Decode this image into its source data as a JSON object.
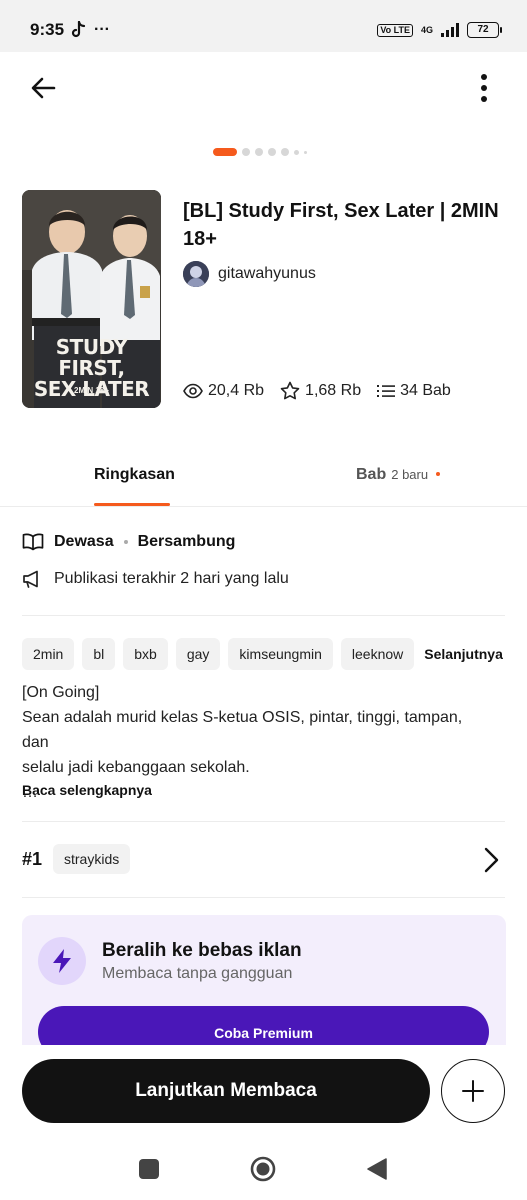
{
  "status_bar": {
    "time": "9:35",
    "overflow": "···",
    "network": "4G",
    "volte": "Vo LTE",
    "battery": "72"
  },
  "header": {
    "back_icon": "arrow-left-icon",
    "more_icon": "more-vertical-icon"
  },
  "carousel": {
    "dot_count": 7,
    "active_index": 0
  },
  "story": {
    "cover_title_line1": "STUDY FIRST,",
    "cover_title_line2": "SEX LATER",
    "cover_subtitle": "2MIN 18+",
    "title": "[BL] Study First, Sex Later | 2MIN 18+",
    "author": "gitawahyunus",
    "reads": "20,4 Rb",
    "votes": "1,68 Rb",
    "parts": "34 Bab"
  },
  "tabs": {
    "summary": "Ringkasan",
    "chapters": "Bab",
    "chapters_badge": "2 baru"
  },
  "meta": {
    "rating": "Dewasa",
    "status": "Bersambung",
    "last_published": "Publikasi terakhir 2 hari yang lalu"
  },
  "tags": [
    "2min",
    "bl",
    "bxb",
    "gay",
    "kimseungmin",
    "leeknow"
  ],
  "tags_more": "Selanjutnya",
  "description": {
    "line1": "[On Going]",
    "line2": "Sean adalah murid kelas S-ketua OSIS, pintar, tinggi, tampan, dan",
    "line3": "selalu jadi kebanggaan sekolah.",
    "ellipsis": "…",
    "read_more": "Baca selengkapnya"
  },
  "ranking": {
    "position": "#1",
    "tag": "straykids"
  },
  "premium": {
    "title": "Beralih ke bebas iklan",
    "subtitle": "Membaca tanpa gangguan",
    "button": "Coba Premium"
  },
  "bottom": {
    "continue": "Lanjutkan Membaca",
    "add_icon": "plus-icon"
  },
  "colors": {
    "accent": "#f55a1d",
    "premium_button": "#4a17b8",
    "premium_bg": "#f3eefc",
    "primary_button": "#121212"
  }
}
